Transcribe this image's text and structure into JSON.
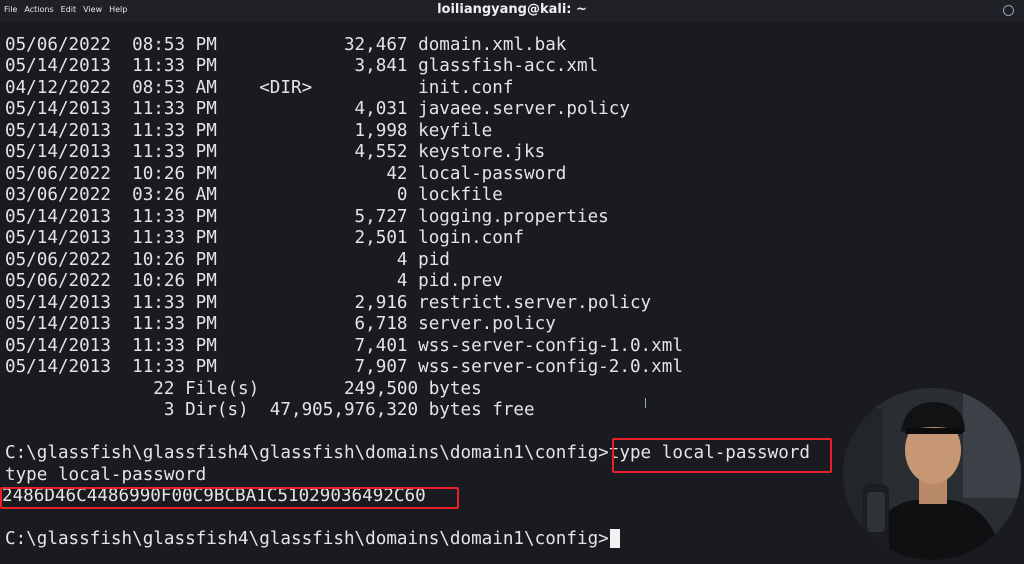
{
  "window": {
    "title": "loiliangyang@kali: ~",
    "menu": [
      "File",
      "Actions",
      "Edit",
      "View",
      "Help"
    ]
  },
  "terminal": {
    "listing": [
      "05/06/2022  08:53 PM            32,467 domain.xml.bak",
      "05/14/2013  11:33 PM             3,841 glassfish-acc.xml",
      "04/12/2022  08:53 AM    <DIR>          init.conf",
      "05/14/2013  11:33 PM             4,031 javaee.server.policy",
      "05/14/2013  11:33 PM             1,998 keyfile",
      "05/14/2013  11:33 PM             4,552 keystore.jks",
      "05/06/2022  10:26 PM                42 local-password",
      "03/06/2022  03:26 AM                 0 lockfile",
      "05/14/2013  11:33 PM             5,727 logging.properties",
      "05/14/2013  11:33 PM             2,501 login.conf",
      "05/06/2022  10:26 PM                 4 pid",
      "05/06/2022  10:26 PM                 4 pid.prev",
      "05/14/2013  11:33 PM             2,916 restrict.server.policy",
      "05/14/2013  11:33 PM             6,718 server.policy",
      "05/14/2013  11:33 PM             7,401 wss-server-config-1.0.xml",
      "05/14/2013  11:33 PM             7,907 wss-server-config-2.0.xml"
    ],
    "summary_files": "              22 File(s)        249,500 bytes",
    "summary_dirs": "               3 Dir(s)  47,905,976,320 bytes free",
    "prompt": "C:\\glassfish\\glassfish4\\glassfish\\domains\\domain1\\config>",
    "command": "type local-password",
    "echo": "type local-password",
    "output": "2486D46C4486990F00C9BCBA1C51029036492C60",
    "final_prompt": "C:\\glassfish\\glassfish4\\glassfish\\domains\\domain1\\config>"
  },
  "colors": {
    "background": "#1a1b20",
    "text": "#e4e4e4",
    "highlight": "#e8202a"
  }
}
